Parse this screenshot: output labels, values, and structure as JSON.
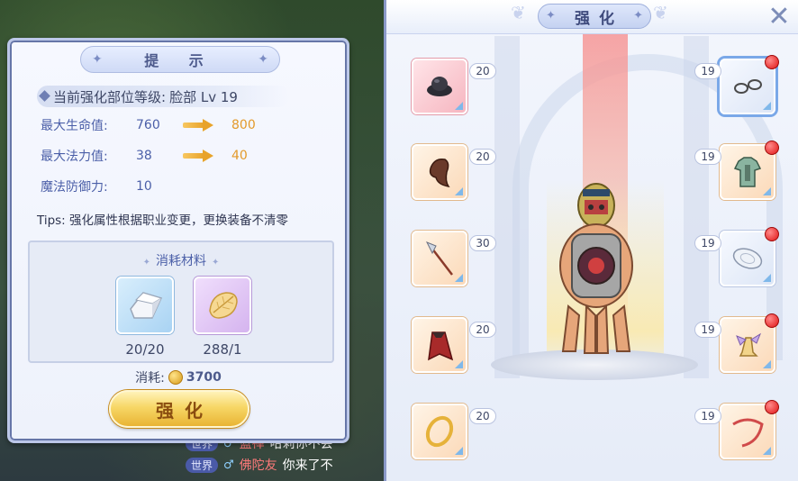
{
  "world": {
    "chat": [
      {
        "channel": "世界",
        "sex": "♂",
        "name": "蓝禅",
        "message": "哈莉你不会"
      },
      {
        "channel": "世界",
        "sex": "♂",
        "name": "佛陀友",
        "message": "你来了不"
      }
    ]
  },
  "tip_panel": {
    "title": "提 示",
    "level_label": "当前强化部位等级:",
    "level_value": "脸部 Lv 19",
    "stats": [
      {
        "label": "最大生命值:",
        "current": "760",
        "next": "800"
      },
      {
        "label": "最大法力值:",
        "current": "38",
        "next": "40"
      },
      {
        "label": "魔法防御力:",
        "current": "10",
        "next": ""
      }
    ],
    "tips": "Tips: 强化属性根据职业变更，更换装备不清零",
    "materials_title": "消耗材料",
    "materials": [
      {
        "icon": "stone-block-icon",
        "count": "20/20"
      },
      {
        "icon": "gold-leaf-icon",
        "count": "288/1"
      }
    ],
    "cost_label": "消耗:",
    "cost_value": "3700",
    "enhance_button": "强化"
  },
  "enhance_panel": {
    "title": "强化",
    "left_slots": [
      {
        "icon": "black-hat-icon",
        "level": "20",
        "style": "pink"
      },
      {
        "icon": "brown-hair-icon",
        "level": "20",
        "style": "peach"
      },
      {
        "icon": "halberd-icon",
        "level": "30",
        "style": "peach"
      },
      {
        "icon": "red-cape-icon",
        "level": "20",
        "style": "peach"
      },
      {
        "icon": "gold-ring-icon",
        "level": "20",
        "style": "peach"
      }
    ],
    "right_slots": [
      {
        "icon": "glasses-icon",
        "level": "19",
        "style": "white",
        "selected": true,
        "alert": true
      },
      {
        "icon": "armor-icon",
        "level": "19",
        "style": "peach",
        "alert": true
      },
      {
        "icon": "shield-icon",
        "level": "19",
        "style": "white",
        "alert": true
      },
      {
        "icon": "winged-boots-icon",
        "level": "19",
        "style": "peach",
        "alert": true
      },
      {
        "icon": "necklace-icon",
        "level": "19",
        "style": "peach",
        "alert": true
      }
    ]
  }
}
